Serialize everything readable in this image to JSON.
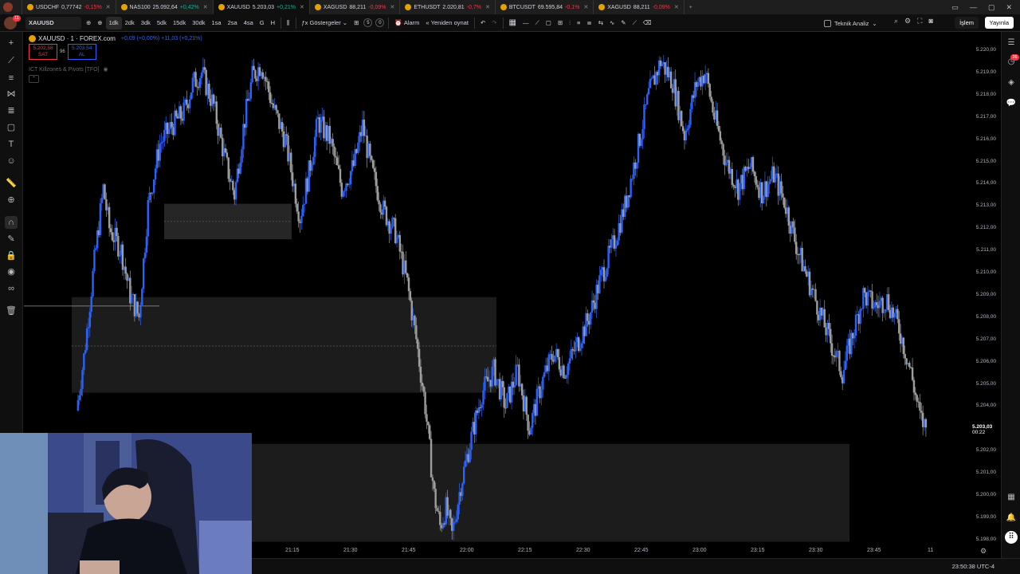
{
  "tabs": [
    {
      "symbol": "USDCHF",
      "price": "0,77742",
      "change": "-0,15%",
      "dir": "dn"
    },
    {
      "symbol": "NAS100",
      "price": "25.092,64",
      "change": "+0,42%",
      "dir": "up"
    },
    {
      "symbol": "XAUUSD",
      "price": "5.203,03",
      "change": "+0,21%",
      "dir": "up",
      "active": true
    },
    {
      "symbol": "XAGUSD",
      "price": "88,211",
      "change": "-0,09%",
      "dir": "dn"
    },
    {
      "symbol": "ETHUSDT",
      "price": "2.020,81",
      "change": "-0,7%",
      "dir": "dn"
    },
    {
      "symbol": "BTCUSDT",
      "price": "69.595,84",
      "change": "-0,1%",
      "dir": "dn"
    },
    {
      "symbol": "XAGUSD",
      "price": "88,211",
      "change": "-0,09%",
      "dir": "dn"
    }
  ],
  "toolbar": {
    "symbol": "XAUUSD",
    "intervals": [
      "1dk",
      "2dk",
      "3dk",
      "5dk",
      "15dk",
      "30dk",
      "1sa",
      "2sa",
      "4sa",
      "G",
      "H"
    ],
    "selected_interval": "1dk",
    "indicators_label": "Göstergeler",
    "indicator_count_a": "5",
    "indicator_count_b": "0",
    "alert_label": "Alarm",
    "replay_label": "Yeniden oynat",
    "tech_analysis_label": "Teknik Analiz",
    "trade_label": "İşlem",
    "publish_label": "Yayınla"
  },
  "legend": {
    "title": "XAUUSD · 1 · FOREX.com",
    "change": "+0,09 (+0,00%) +11,03 (+0,21%)",
    "sell_price": "5.202,58",
    "sell_label": "SAT",
    "spread": "96",
    "buy_price": "5.203,54",
    "buy_label": "AL",
    "indicator_name": "ICT Killzones & Pivots [TFO]"
  },
  "price_axis": [
    "5.220,00",
    "5.219,00",
    "5.218,00",
    "5.217,00",
    "5.216,00",
    "5.215,00",
    "5.214,00",
    "5.213,00",
    "5.212,00",
    "5.211,00",
    "5.210,00",
    "5.209,00",
    "5.208,00",
    "5.207,00",
    "5.206,00",
    "5.205,00",
    "5.204,00",
    "5.203,00",
    "5.202,00",
    "5.201,00",
    "5.200,00",
    "5.199,00",
    "5.198,00"
  ],
  "last_price": {
    "price": "5.203,03",
    "countdown": "00:22"
  },
  "time_axis": [
    "21:15",
    "21:30",
    "21:45",
    "22:00",
    "22:15",
    "22:30",
    "22:45",
    "23:00",
    "23:15",
    "23:30",
    "23:45",
    "11"
  ],
  "status": {
    "clock": "23:50:38 UTC-4"
  },
  "notification_badge": "26",
  "colors": {
    "bull": "#2962ff",
    "bear": "#9e9e9e",
    "zone": "#2a2a2a",
    "background": "#000000"
  }
}
